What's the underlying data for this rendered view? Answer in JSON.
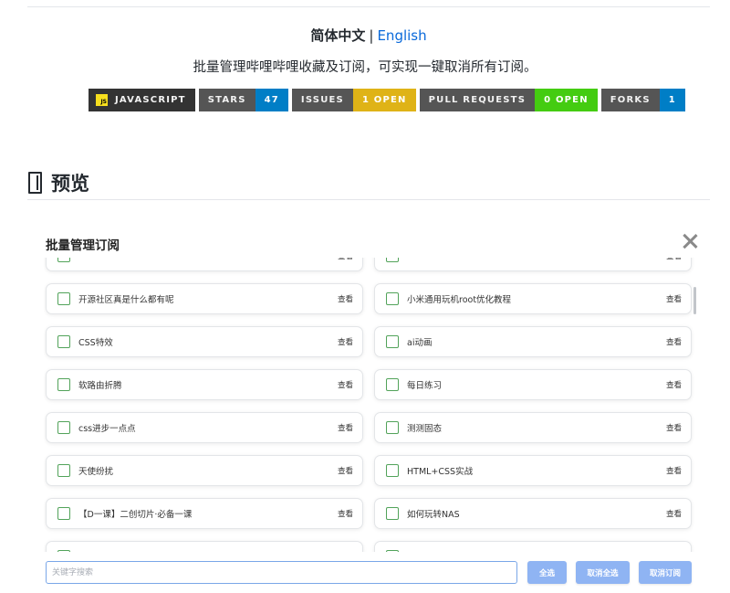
{
  "header": {
    "lang_current": "简体中文",
    "lang_separator": "|",
    "lang_other": "English",
    "description": "批量管理哔哩哔哩收藏及订阅，可实现一键取消所有订阅。"
  },
  "badges": [
    {
      "label": "JAVASCRIPT",
      "value": "",
      "icon": "js-logo-icon",
      "logo_text": "JS",
      "color": "#333333"
    },
    {
      "label": "STARS",
      "value": "47",
      "color": "#007ec6"
    },
    {
      "label": "ISSUES",
      "value": "1 OPEN",
      "color": "#dfb317"
    },
    {
      "label": "PULL REQUESTS",
      "value": "0 OPEN",
      "color": "#4c1"
    },
    {
      "label": "FORKS",
      "value": "1",
      "color": "#007ec6"
    }
  ],
  "section": {
    "icon": "book-icon",
    "title": "预览"
  },
  "modal": {
    "title": "批量管理订阅",
    "close_icon": "close-icon",
    "view_label": "查看",
    "items": [
      {
        "label": ""
      },
      {
        "label": ""
      },
      {
        "label": "开源社区真是什么都有呢"
      },
      {
        "label": "小米通用玩机root优化教程"
      },
      {
        "label": "CSS特效"
      },
      {
        "label": "ai动画"
      },
      {
        "label": "软路由折腾"
      },
      {
        "label": "每日练习"
      },
      {
        "label": "css进步一点点"
      },
      {
        "label": "测测固态"
      },
      {
        "label": "天使纷扰"
      },
      {
        "label": "HTML+CSS实战"
      },
      {
        "label": "【D一课】二创切片·必备一课"
      },
      {
        "label": "如何玩转NAS"
      },
      {
        "label": ""
      },
      {
        "label": ""
      }
    ],
    "search_placeholder": "关键字搜索",
    "select_all": "全选",
    "deselect_all": "取消全选",
    "unsubscribe": "取消订阅",
    "button_color": "#8fb4f3",
    "checkbox_color": "#52a35a"
  }
}
